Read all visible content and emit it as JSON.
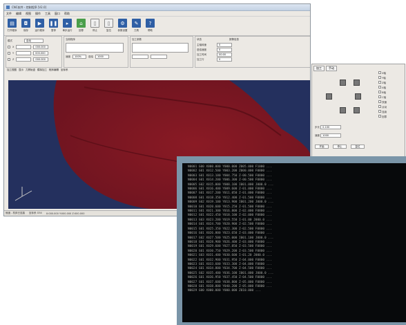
{
  "window": {
    "title": "CNC软件 - 控制程序 [V2.0]"
  },
  "menu": [
    "文件",
    "编辑",
    "视图",
    "操作",
    "工具",
    "窗口",
    "帮助"
  ],
  "toolbar": [
    {
      "label": "打开程序",
      "icon": "folder-icon",
      "style": "blue"
    },
    {
      "label": "保存",
      "icon": "save-icon",
      "style": "blue"
    },
    {
      "label": "运行程序",
      "icon": "run-icon",
      "style": "blue"
    },
    {
      "label": "暂停",
      "icon": "pause-icon",
      "style": "blue"
    },
    {
      "label": "单步运行",
      "icon": "step-icon",
      "style": "blue"
    },
    {
      "label": "回零",
      "icon": "home-icon",
      "style": "green"
    },
    {
      "label": "停止",
      "icon": "stop-icon",
      "style": "grey"
    },
    {
      "label": "复位",
      "icon": "reset-icon",
      "style": "grey"
    },
    {
      "label": "参数设置",
      "icon": "settings-icon",
      "style": "blue"
    },
    {
      "label": "刀具",
      "icon": "tool-icon",
      "style": "blue"
    },
    {
      "label": "帮助",
      "icon": "help-icon",
      "style": "blue"
    }
  ],
  "coords": [
    {
      "axis": "X",
      "value": "000.000"
    },
    {
      "axis": "Y",
      "value": "000.000"
    },
    {
      "axis": "Z",
      "value": "000.000"
    }
  ],
  "panel": {
    "mode_label": "模式",
    "mode_value": "自动",
    "g1_title": "当前程序",
    "g2_title": "加工参数",
    "speed_label": "速度",
    "speed_value": "100%",
    "feed_label": "进给",
    "feed_value": "1000",
    "g3_title": "状态",
    "status_rows": [
      {
        "label": "主轴转速",
        "value": "0"
      },
      {
        "label": "进给速度",
        "value": "0"
      },
      {
        "label": "加工时间",
        "value": "00:00"
      },
      {
        "label": "加工行",
        "value": "0"
      }
    ],
    "g3b_title": "报警信息"
  },
  "tabs": [
    "加工视图",
    "显示",
    "刀具轨迹",
    "模拟加工",
    "程序编辑",
    "坐标系"
  ],
  "side": {
    "tabs": [
      "加工",
      "手动"
    ],
    "options": [
      "X轴",
      "Y轴",
      "Z轴",
      "A轴",
      "B轴",
      "C轴",
      "快速",
      "点动",
      "连续",
      "回零"
    ],
    "step_label": "步长",
    "step_value": "0.100",
    "speed_label": "速度",
    "speed_value": "1000",
    "btn_start": "开始",
    "btn_stop": "停止",
    "btn_reset": "复位"
  },
  "statusbar": {
    "left": "就绪 - 机床已连接",
    "mid": "坐标系 G54",
    "right": "X:000.000 Y:000.000 Z:000.000"
  },
  "console": {
    "lines": [
      "N0001 G00 X000.000 Y000.000 Z005.000 F1000 ...",
      "N0002 G01 X012.500 Y003.200 Z000.000 F0800 ...",
      "N0003 G01 X013.100 Y004.750 Z-00.500 F0800 ...",
      "N0004 G01 X014.200 Y006.300 Z-00.500 F0800 ...",
      "N0005 G02 X015.000 Y008.100 I001.000 J000.0 ...",
      "N0006 G01 X016.400 Y009.600 Z-01.000 F0800 ...",
      "N0007 G01 X017.200 Y011.050 Z-01.000 F0800 ...",
      "N0008 G01 X018.350 Y012.400 Z-01.500 F0800 ...",
      "N0009 G02 X019.100 Y013.900 I001.200 J000.0 ...",
      "N0010 G01 X020.600 Y015.250 Z-01.500 F0800 ...",
      "N0011 G01 X021.300 Y016.800 Z-02.000 F0800 ...",
      "N0012 G01 X022.450 Y018.100 Z-02.000 F0800 ...",
      "N0013 G03 X023.200 Y019.550 I-01.00 J000.0 ...",
      "N0014 G01 X024.700 Y020.900 Z-02.500 F0800 ...",
      "N0015 G01 X025.350 Y022.300 Z-02.500 F0800 ...",
      "N0016 G01 X026.800 Y023.650 Z-03.000 F0800 ...",
      "N0017 G02 X027.500 Y025.000 I001.100 J000.0 ...",
      "N0018 G01 X028.900 Y026.400 Z-03.000 F0800 ...",
      "N0019 G01 X029.600 Y027.850 Z-03.500 F0800 ...",
      "N0020 G01 X030.750 Y029.200 Z-03.500 F0800 ...",
      "N0021 G03 X031.400 Y030.600 I-01.20 J000.0 ...",
      "N0022 G01 X032.900 Y031.950 Z-04.000 F0800 ...",
      "N0023 G01 X033.600 Y033.300 Z-04.000 F0800 ...",
      "N0024 G01 X034.800 Y034.700 Z-04.500 F0800 ...",
      "N0025 G02 X035.400 Y036.100 I001.000 J000.0 ...",
      "N0026 G01 X036.950 Y037.450 Z-04.500 F0800 ...",
      "N0027 G01 X037.600 Y038.800 Z-05.000 F0800 ...",
      "N0028 G01 X038.800 Y040.200 Z-05.000 F0800 ...",
      "N0029 G00 X000.000 Y000.000 Z010.000 ..."
    ]
  }
}
